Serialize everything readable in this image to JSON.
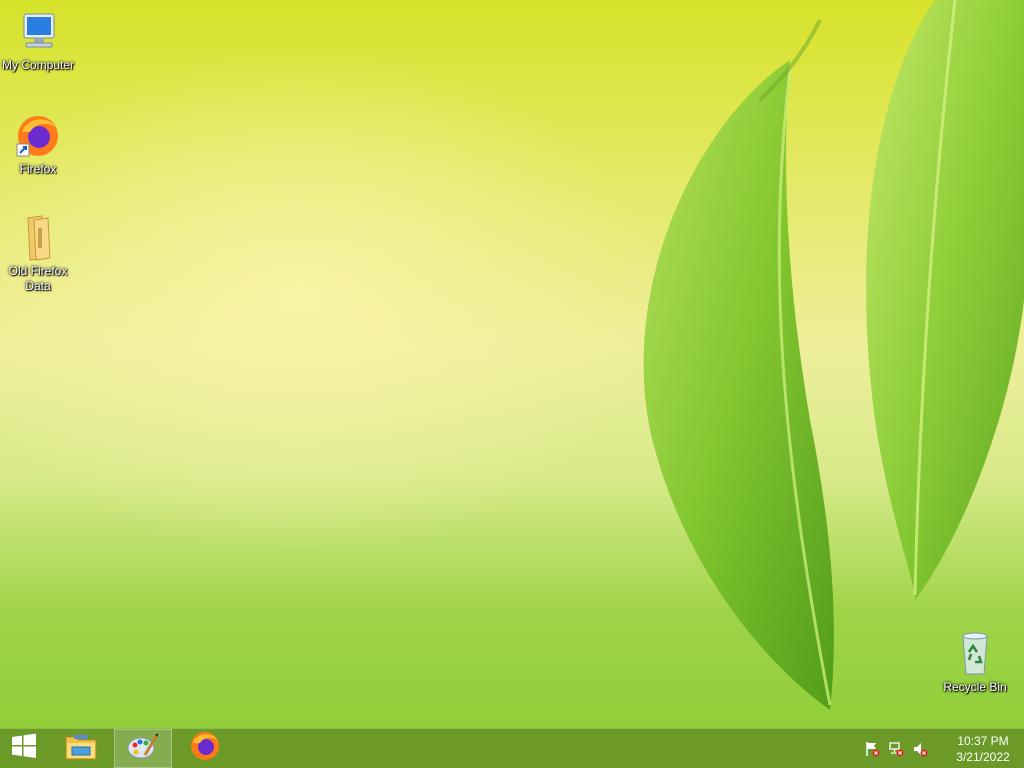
{
  "desktop": {
    "icons": [
      {
        "label": "My Computer",
        "icon": "computer-icon"
      },
      {
        "label": "Firefox",
        "icon": "firefox-shortcut-icon"
      },
      {
        "label": "Old Firefox Data",
        "icon": "folder-icon"
      },
      {
        "label": "Recycle Bin",
        "icon": "recycle-bin-icon"
      }
    ]
  },
  "taskbar": {
    "start": {
      "icon": "windows-logo-icon"
    },
    "pinned": [
      {
        "name": "File Explorer",
        "icon": "file-explorer-icon"
      },
      {
        "name": "Paint",
        "icon": "paint-icon",
        "active": true
      },
      {
        "name": "Firefox",
        "icon": "firefox-icon"
      }
    ],
    "tray": {
      "icons": [
        "action-center-flag-icon",
        "network-icon",
        "volume-muted-icon"
      ],
      "time": "10:37 PM",
      "date": "3/21/2022"
    }
  },
  "colors": {
    "taskbar": "#68962a",
    "wallpaper_top": "#d6e32a",
    "wallpaper_bottom": "#8ccc34",
    "leaf": "#7cc42a"
  }
}
